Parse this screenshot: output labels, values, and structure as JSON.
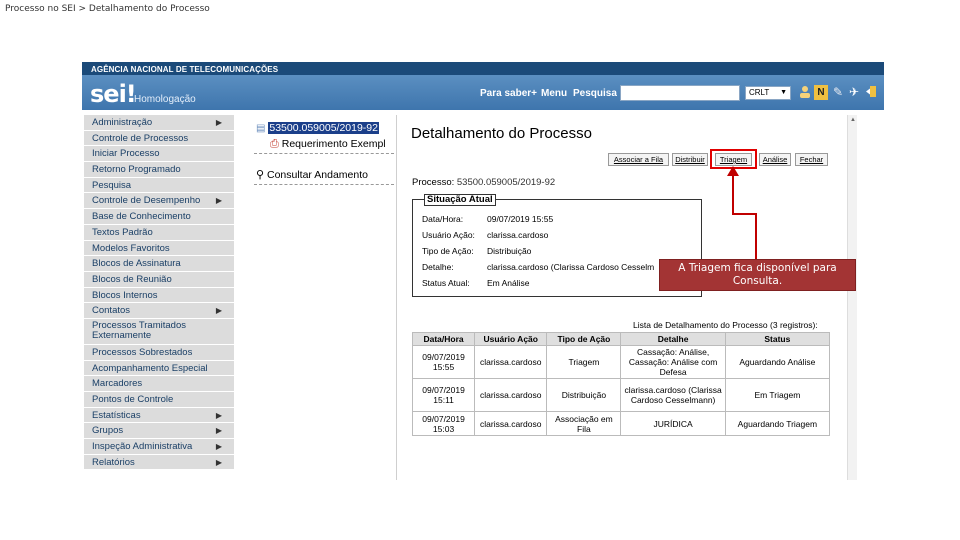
{
  "slide": {
    "title": "Processo no SEI > Detalhamento do Processo"
  },
  "header": {
    "agency": "AGÊNCIA NACIONAL DE TELECOMUNICAÇÕES",
    "logo": "sei!",
    "environment": "Homologação",
    "links": [
      "Para saber+",
      "Menu",
      "Pesquisa"
    ],
    "search_placeholder": "",
    "unit_selected": "CRLT",
    "icons": [
      "user-icon",
      "notes-icon",
      "settings-icon",
      "exit-icon"
    ]
  },
  "sidebar": {
    "items": [
      {
        "label": "Administração",
        "arrow": "▶"
      },
      {
        "label": "Controle de Processos",
        "arrow": ""
      },
      {
        "label": "Iniciar Processo",
        "arrow": ""
      },
      {
        "label": "Retorno Programado",
        "arrow": ""
      },
      {
        "label": "Pesquisa",
        "arrow": ""
      },
      {
        "label": "Controle de Desempenho",
        "arrow": "▶"
      },
      {
        "label": "Base de Conhecimento",
        "arrow": ""
      },
      {
        "label": "Textos Padrão",
        "arrow": ""
      },
      {
        "label": "Modelos Favoritos",
        "arrow": ""
      },
      {
        "label": "Blocos de Assinatura",
        "arrow": ""
      },
      {
        "label": "Blocos de Reunião",
        "arrow": ""
      },
      {
        "label": "Blocos Internos",
        "arrow": ""
      },
      {
        "label": "Contatos",
        "arrow": "▶"
      },
      {
        "label": "Processos Tramitados Externamente",
        "arrow": ""
      },
      {
        "label": "Processos Sobrestados",
        "arrow": ""
      },
      {
        "label": "Acompanhamento Especial",
        "arrow": ""
      },
      {
        "label": "Marcadores",
        "arrow": ""
      },
      {
        "label": "Pontos de Controle",
        "arrow": ""
      },
      {
        "label": "Estatísticas",
        "arrow": "▶"
      },
      {
        "label": "Grupos",
        "arrow": "▶"
      },
      {
        "label": "Inspeção Administrativa",
        "arrow": "▶"
      },
      {
        "label": "Relatórios",
        "arrow": "▶"
      }
    ]
  },
  "tree": {
    "process_number": "53500.059005/2019-92",
    "document": "Requerimento Exempl",
    "consult": "Consultar Andamento"
  },
  "main": {
    "title": "Detalhamento do Processo",
    "buttons": [
      "Associar a Fila",
      "Distribuir",
      "Triagem",
      "Análise",
      "Fechar"
    ],
    "process_label": "Processo:",
    "process_number": "53500.059005/2019-92",
    "situacao": {
      "legend": "Situação Atual",
      "rows": [
        {
          "label": "Data/Hora:",
          "value": "09/07/2019 15:55"
        },
        {
          "label": "Usuário Ação:",
          "value": "clarissa.cardoso"
        },
        {
          "label": "Tipo de Ação:",
          "value": "Distribuição"
        },
        {
          "label": "Detalhe:",
          "value": "clarissa.cardoso (Clarissa Cardoso Cesselm"
        },
        {
          "label": "Status Atual:",
          "value": "Em Análise"
        }
      ]
    },
    "list_caption": "Lista de Detalhamento do Processo (3 registros):",
    "table": {
      "headers": [
        "Data/Hora",
        "Usuário Ação",
        "Tipo de Ação",
        "Detalhe",
        "Status"
      ],
      "rows": [
        [
          "09/07/2019 15:55",
          "clarissa.cardoso",
          "Triagem",
          "Cassação: Análise, Cassação: Análise com Defesa",
          "Aguardando Análise"
        ],
        [
          "09/07/2019 15:11",
          "clarissa.cardoso",
          "Distribuição",
          "clarissa.cardoso (Clarissa Cardoso Cesselmann)",
          "Em Triagem"
        ],
        [
          "09/07/2019 15:03",
          "clarissa.cardoso",
          "Associação em Fila",
          "JURÍDICA",
          "Aguardando Triagem"
        ]
      ]
    }
  },
  "annotation": {
    "callout": "A Triagem fica disponível para Consulta.",
    "color": "#a33434",
    "highlight_color": "#e00000"
  }
}
